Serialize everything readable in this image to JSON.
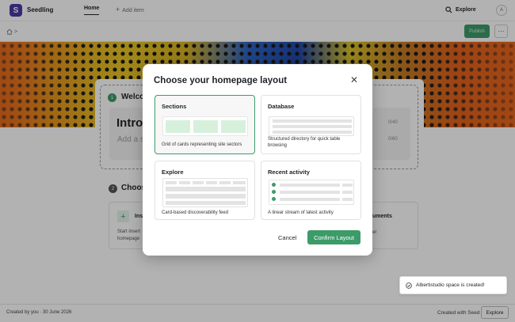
{
  "app": {
    "logo_letter": "S",
    "name": "Seedling"
  },
  "nav": {
    "home": "Home",
    "add_item": "Add item",
    "explore": "Explore",
    "avatar_initial": "A"
  },
  "breadcrumb": {
    "separator": ">"
  },
  "toolbar": {
    "publish": "Publish",
    "more": "···"
  },
  "page": {
    "step1_number": "1",
    "step1_title": "Welco",
    "intro_title": "Intro",
    "add_placeholder": "Add a s",
    "count_title": "0/40",
    "count_desc": "0/60",
    "step2_number": "2",
    "step2_title": "Choos",
    "option1_title": "Ins",
    "option1_desc": "Start insert homepage",
    "option2_title": "uments",
    "option2_desc": "er"
  },
  "toast": {
    "text": "Albertistudio space is created!"
  },
  "footer": {
    "created": "Created by you · 30 June 2026",
    "created_with": "Created with Seed",
    "explore": "Explore"
  },
  "modal": {
    "title": "Choose your homepage layout",
    "options": [
      {
        "title": "Sections",
        "desc": "Grid of cards representing site sectors",
        "selected": true
      },
      {
        "title": "Database",
        "desc": "Structured directory for quick table browsing",
        "selected": false
      },
      {
        "title": "Explore",
        "desc": "Card-based discoverability feed",
        "selected": false
      },
      {
        "title": "Recent activity",
        "desc": "A linear stream of latest activity",
        "selected": false
      }
    ],
    "cancel": "Cancel",
    "confirm": "Confirm Layout"
  },
  "colors": {
    "accent": "#3d9b6a",
    "brand": "#4b3aa6",
    "selected_tile": "#d6f0dc"
  }
}
